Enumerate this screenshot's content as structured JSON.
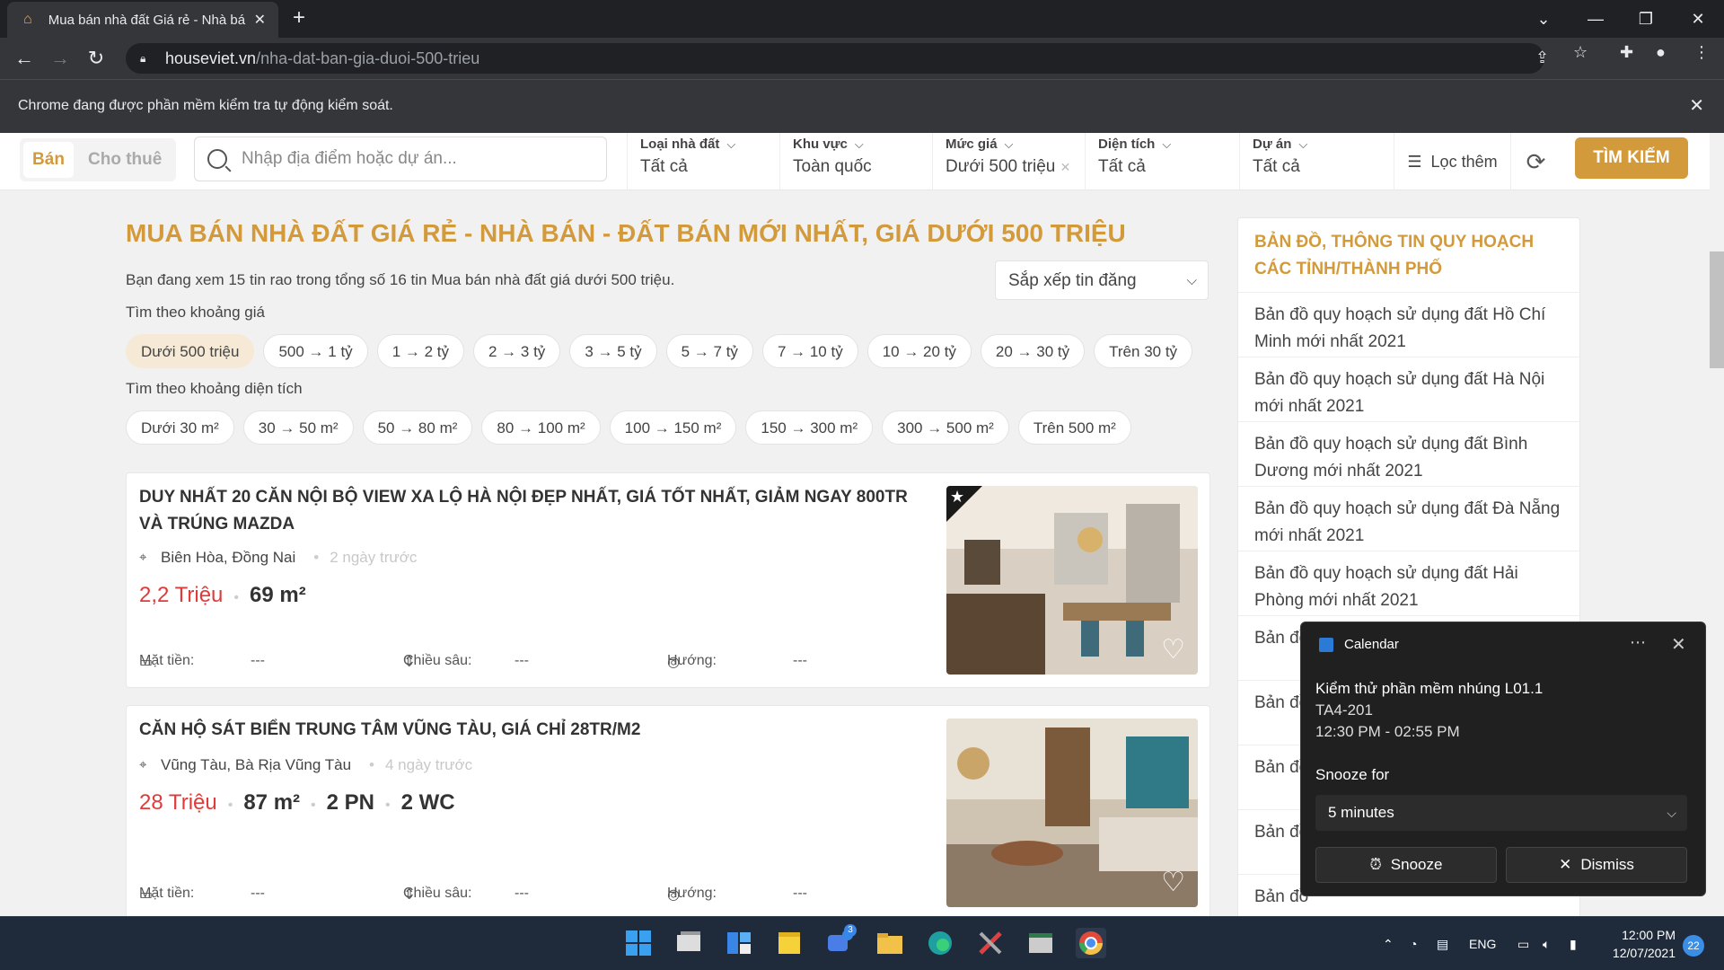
{
  "browser": {
    "tab_title": "Mua bán nhà đất Giá rẻ - Nhà bá",
    "url_domain": "houseviet.vn",
    "url_path": "/nha-dat-ban-gia-duoi-500-trieu",
    "automation_notice": "Chrome đang được phần mềm kiểm tra tự động kiểm soát."
  },
  "search": {
    "tab_sell": "Bán",
    "tab_rent": "Cho thuê",
    "placeholder": "Nhập địa điểm hoặc dự án...",
    "filters": [
      {
        "label": "Loại nhà đất",
        "value": "Tất cả"
      },
      {
        "label": "Khu vực",
        "value": "Toàn quốc"
      },
      {
        "label": "Mức giá",
        "value": "Dưới 500 triệu"
      },
      {
        "label": "Diện tích",
        "value": "Tất cả"
      },
      {
        "label": "Dự án",
        "value": "Tất cả"
      }
    ],
    "more_filters": "Lọc thêm",
    "search_button": "TÌM KIẾM"
  },
  "main": {
    "title": "MUA BÁN NHÀ ĐẤT GIÁ RẺ - NHÀ BÁN - ĐẤT BÁN MỚI NHẤT, GIÁ DƯỚI 500 TRIỆU",
    "summary": "Bạn đang xem 15 tin rao trong tổng số 16 tin Mua bán nhà đất giá dưới 500 triệu.",
    "sort_label": "Sắp xếp tin đăng",
    "price_section": "Tìm theo khoảng giá",
    "price_chips": [
      "Dưới 500 triệu",
      "500 → 1 tỷ",
      "1 → 2 tỷ",
      "2 → 3 tỷ",
      "3 → 5 tỷ",
      "5 → 7 tỷ",
      "7 → 10 tỷ",
      "10 → 20 tỷ",
      "20 → 30 tỷ",
      "Trên 30 tỷ"
    ],
    "area_section": "Tìm theo khoảng diện tích",
    "area_chips": [
      "Dưới 30 m²",
      "30 → 50 m²",
      "50 → 80 m²",
      "80 → 100 m²",
      "100 → 150 m²",
      "150 → 300 m²",
      "300 → 500 m²",
      "Trên 500 m²"
    ],
    "listings": [
      {
        "title": "DUY NHẤT 20 CĂN NỘI BỘ VIEW XA LỘ HÀ NỘI ĐẸP NHẤT, GIÁ TỐT NHẤT, GIẢM NGAY 800TR VÀ TRÚNG MAZDA",
        "location": "Biên Hòa, Đồng Nai",
        "time": "2 ngày trước",
        "price": "2,2 Triệu",
        "area": "69 m²",
        "frontage_label": "Mặt tiền:",
        "frontage": "---",
        "depth_label": "Chiều sâu:",
        "depth": "---",
        "direction_label": "Hướng:",
        "direction": "---"
      },
      {
        "title": "CĂN HỘ SÁT BIỂN TRUNG TÂM VŨNG TÀU, GIÁ CHỈ 28TR/M2",
        "location": "Vũng Tàu, Bà Rịa Vũng Tàu",
        "time": "4 ngày trước",
        "price": "28 Triệu",
        "area": "87 m²",
        "bedrooms": "2 PN",
        "bathrooms": "2 WC",
        "frontage_label": "Mặt tiền:",
        "frontage": "---",
        "depth_label": "Chiều sâu:",
        "depth": "---",
        "direction_label": "Hướng:",
        "direction": "---"
      }
    ]
  },
  "sidebar": {
    "heading": "BẢN ĐỒ, THÔNG TIN QUY HOẠCH CÁC TỈNH/THÀNH PHỐ",
    "items": [
      "Bản đồ quy hoạch sử dụng đất Hồ Chí Minh mới nhất 2021",
      "Bản đồ quy hoạch sử dụng đất Hà Nội mới nhất 2021",
      "Bản đồ quy hoạch sử dụng đất Bình Dương mới nhất 2021",
      "Bản đồ quy hoạch sử dụng đất Đà Nẵng mới nhất 2021",
      "Bản đồ quy hoạch sử dụng đất Hải Phòng mới nhất 2021",
      "Bản đồ",
      "Bản đồ",
      "Bản đồ",
      "Bản đồ",
      "Bản đồ"
    ]
  },
  "notification": {
    "app": "Calendar",
    "event": "Kiểm thử phần mềm nhúng L01.1",
    "room": "TA4-201",
    "time": "12:30 PM - 02:55 PM",
    "snooze_label": "Snooze for",
    "snooze_value": "5 minutes",
    "snooze_button": "Snooze",
    "dismiss_button": "Dismiss"
  },
  "taskbar": {
    "language": "ENG",
    "time": "12:00 PM",
    "date": "12/07/2021",
    "notification_count": "22",
    "teams_badge": "3"
  }
}
